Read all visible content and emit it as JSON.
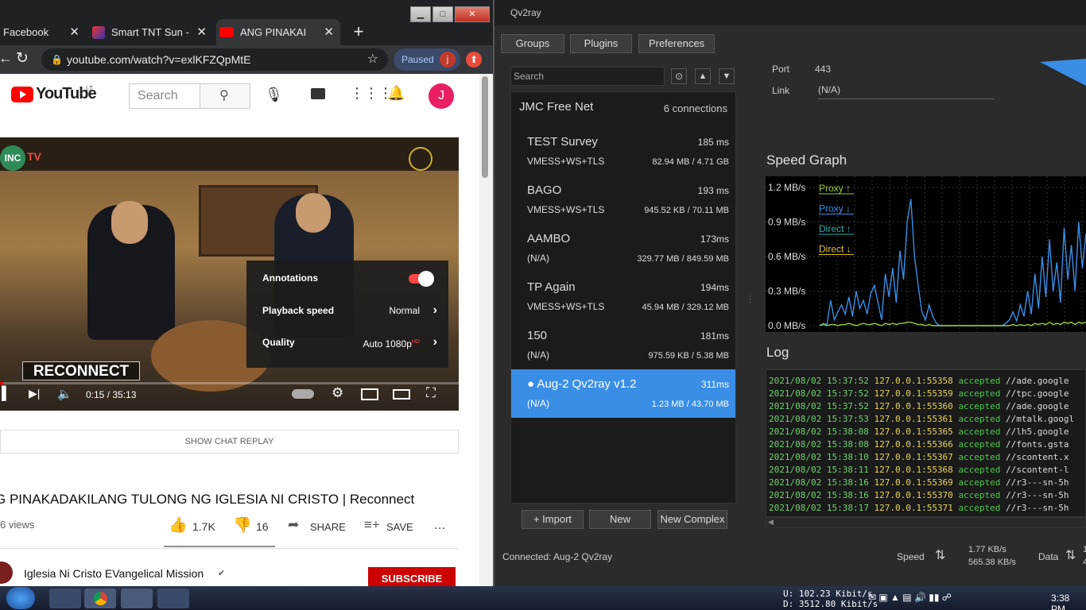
{
  "chrome": {
    "tabs": [
      {
        "label": "Facebook",
        "close": "✕"
      },
      {
        "label": "Smart TNT Sun -",
        "close": "✕"
      },
      {
        "label": "ANG PINAKAI",
        "close": "✕"
      }
    ],
    "new_tab": "+",
    "url": "youtube.com/watch?v=exlKFZQpMtE",
    "paused_label": "Paused",
    "profile_initial": "j"
  },
  "youtube": {
    "logo": "YouTube",
    "logo_sup": "LT",
    "search_placeholder": "Search",
    "avatar_initial": "J",
    "video": {
      "channel_badge": "INC",
      "channel_badge_suffix": "TV",
      "overlay_title": "RECONNECT",
      "time": "0:15 / 35:13",
      "settings_menu": [
        {
          "label": "Annotations",
          "value": ""
        },
        {
          "label": "Playback speed",
          "value": "Normal"
        },
        {
          "label": "Quality",
          "value": "Auto 1080p",
          "value_sup": "HD"
        }
      ]
    },
    "chat_replay": "SHOW CHAT REPLAY",
    "title": "G PINAKADAKILANG TULONG NG IGLESIA NI CRISTO | Reconnect",
    "views": "6 views",
    "likes": "1.7K",
    "dislikes": "16",
    "share": "SHARE",
    "save": "SAVE",
    "more": "...",
    "channel_name": "Iglesia Ni Cristo EVangelical Mission",
    "subscribe": "SUBSCRIBE"
  },
  "qv2ray": {
    "title": "Qv2ray",
    "top_buttons": [
      "Groups",
      "Plugins",
      "Preferences"
    ],
    "search_placeholder": "Search",
    "group": {
      "name": "JMC Free Net",
      "count": "6 connections"
    },
    "connections": [
      {
        "name": "TEST Survey",
        "latency": "185 ms",
        "protocol": "VMESS+WS+TLS",
        "data": "82.94 MB / 4.71 GB",
        "selected": false
      },
      {
        "name": "BAGO",
        "latency": "193 ms",
        "protocol": "VMESS+WS+TLS",
        "data": "945.52 KB / 70.11 MB",
        "selected": false
      },
      {
        "name": "AAMBO",
        "latency": "173ms",
        "protocol": "(N/A)",
        "data": "329.77 MB / 849.59 MB",
        "selected": false
      },
      {
        "name": "TP Again",
        "latency": "194ms",
        "protocol": "VMESS+WS+TLS",
        "data": "45.94 MB / 329.12 MB",
        "selected": false
      },
      {
        "name": "150",
        "latency": "181ms",
        "protocol": "(N/A)",
        "data": "975.59 KB / 5.38 MB",
        "selected": false
      },
      {
        "name": "● Aug-2 Qv2ray v1.2",
        "latency": "311ms",
        "protocol": "(N/A)",
        "data": "1.23 MB / 43.70 MB",
        "selected": true
      }
    ],
    "bottom_buttons": [
      "+ Import",
      "New",
      "New Complex"
    ],
    "port_label": "Port",
    "port_value": "443",
    "link_label": "Link",
    "link_value": "(N/A)",
    "speed_graph_title": "Speed Graph",
    "log_title": "Log",
    "connected": "Connected: Aug-2 Qv2ray",
    "speed_label": "Speed",
    "speed_up": "1.77 KB/s",
    "speed_down": "565.38 KB/s",
    "data_label": "Data",
    "data_up_partial": "1.",
    "data_down_partial": "4:",
    "log": [
      {
        "date": "2021/08/02 15:37:52",
        "addr": "127.0.0.1:55358",
        "status": "accepted",
        "host": "//ade.google"
      },
      {
        "date": "2021/08/02 15:37:52",
        "addr": "127.0.0.1:55359",
        "status": "accepted",
        "host": "//tpc.google"
      },
      {
        "date": "2021/08/02 15:37:52",
        "addr": "127.0.0.1:55360",
        "status": "accepted",
        "host": "//ade.google"
      },
      {
        "date": "2021/08/02 15:37:53",
        "addr": "127.0.0.1:55361",
        "status": "accepted",
        "host": "//mtalk.googl"
      },
      {
        "date": "2021/08/02 15:38:08",
        "addr": "127.0.0.1:55365",
        "status": "accepted",
        "host": "//lh5.google"
      },
      {
        "date": "2021/08/02 15:38:08",
        "addr": "127.0.0.1:55366",
        "status": "accepted",
        "host": "//fonts.gsta"
      },
      {
        "date": "2021/08/02 15:38:10",
        "addr": "127.0.0.1:55367",
        "status": "accepted",
        "host": "//scontent.x"
      },
      {
        "date": "2021/08/02 15:38:11",
        "addr": "127.0.0.1:55368",
        "status": "accepted",
        "host": "//scontent-l"
      },
      {
        "date": "2021/08/02 15:38:16",
        "addr": "127.0.0.1:55369",
        "status": "accepted",
        "host": "//r3---sn-5h"
      },
      {
        "date": "2021/08/02 15:38:16",
        "addr": "127.0.0.1:55370",
        "status": "accepted",
        "host": "//r3---sn-5h"
      },
      {
        "date": "2021/08/02 15:38:17",
        "addr": "127.0.0.1:55371",
        "status": "accepted",
        "host": "//r3---sn-5h"
      }
    ]
  },
  "chart_data": {
    "type": "line",
    "title": "Speed Graph",
    "ylim": [
      0,
      1.2
    ],
    "yticks": [
      "1.2 MB/s",
      "0.9 MB/s",
      "0.6 MB/s",
      "0.3 MB/s",
      "0.0 MB/s"
    ],
    "legend": [
      {
        "name": "Proxy ↑",
        "color": "#9acd32"
      },
      {
        "name": "Proxy ↓",
        "color": "#3a8ee6"
      },
      {
        "name": "Direct ↑",
        "color": "#20b2aa"
      },
      {
        "name": "Direct ↓",
        "color": "#e0c020"
      }
    ],
    "grid": true,
    "legend_placement": "top-left",
    "series": [
      {
        "name": "Proxy ↓",
        "color": "#3a8ee6",
        "values": [
          0,
          0.02,
          0.01,
          0.22,
          0.05,
          0.12,
          0.18,
          0.1,
          0.25,
          0.08,
          0.3,
          0.15,
          0.22,
          0.1,
          0.28,
          0.35,
          0.2,
          0.05,
          0.45,
          0.25,
          0.5,
          0.2,
          0.65,
          0.4,
          0.9,
          1.1,
          0.6,
          0.35,
          0.12,
          0.05,
          0.18,
          0.08,
          0.02,
          0,
          0,
          0,
          0,
          0,
          0,
          0,
          0,
          0,
          0,
          0,
          0,
          0,
          0,
          0,
          0,
          0,
          0,
          0.02,
          0.05,
          0.12,
          0.04,
          0.18,
          0.08,
          0.3,
          0.1,
          0.45,
          0.15,
          0.6,
          0.25,
          0.75,
          0.3,
          0.55,
          0.2,
          0.85,
          0.4,
          0.7,
          0.3,
          0.9,
          0.5,
          0.8
        ]
      },
      {
        "name": "Proxy ↑",
        "color": "#9acd32",
        "values": [
          0,
          0.01,
          0,
          0.01,
          0.01,
          0,
          0.01,
          0.01,
          0.02,
          0.01,
          0,
          0.01,
          0.02,
          0.01,
          0.01,
          0.02,
          0.01,
          0,
          0.02,
          0.01,
          0.02,
          0.01,
          0.02,
          0.02,
          0.03,
          0.03,
          0.02,
          0.01,
          0.01,
          0,
          0.01,
          0,
          0,
          0,
          0,
          0,
          0,
          0,
          0,
          0,
          0,
          0,
          0,
          0,
          0,
          0,
          0,
          0,
          0,
          0,
          0,
          0,
          0,
          0.01,
          0,
          0.01,
          0,
          0.01,
          0,
          0.02,
          0.01,
          0.02,
          0.01,
          0.03,
          0.01,
          0.02,
          0.01,
          0.03,
          0.02,
          0.03,
          0.01,
          0.03,
          0.02,
          0.03
        ]
      }
    ]
  },
  "taskbar": {
    "net_up": "U:   102.23 Kibit/s",
    "net_down": "D:  3512.80 Kibit/s",
    "clock": "3:38 PM"
  }
}
